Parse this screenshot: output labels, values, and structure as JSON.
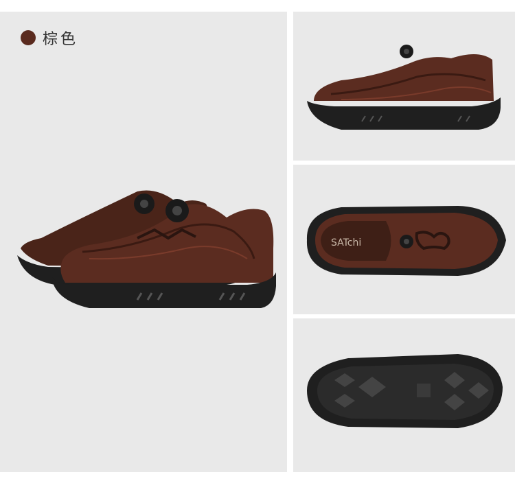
{
  "colors": {
    "background": "#e9e9e9",
    "swatch": "#5a2a1e",
    "leather_dark": "#3e1f16",
    "leather": "#5b2c20",
    "leather_light": "#7a3b2b",
    "sole": "#1f1f1f"
  },
  "variant": {
    "name": "棕色"
  },
  "insole_brand": "SATchi"
}
